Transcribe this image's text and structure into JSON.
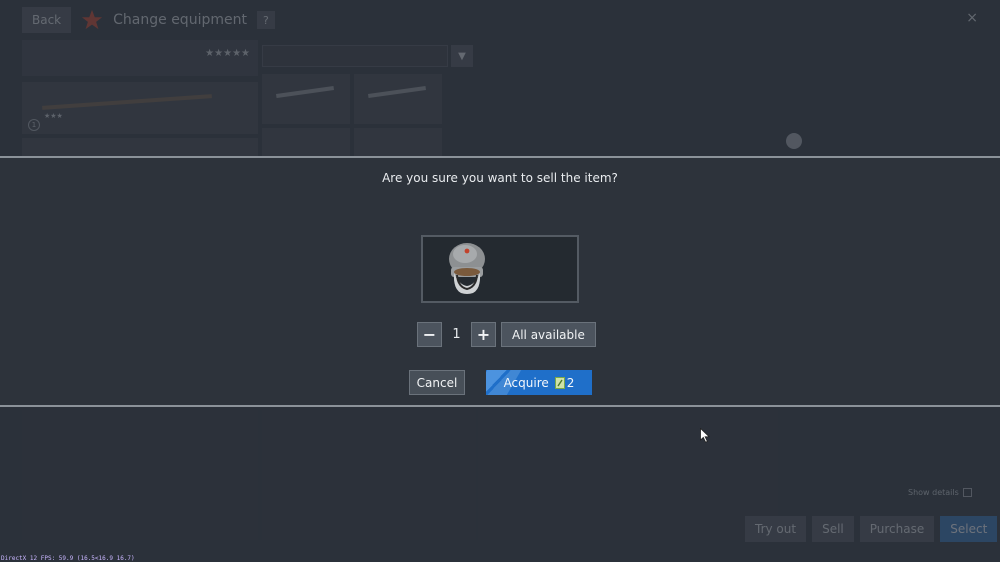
{
  "background": {
    "back_label": "Back",
    "page_title": "Change equipment",
    "help_label": "?",
    "close_label": "×",
    "soldier": {
      "stats": "",
      "price": "",
      "name": "",
      "rating": "★★★★★"
    },
    "weapon_1": {
      "price": "",
      "name": "",
      "number": "1",
      "stars": "★★★"
    },
    "weapon_2": {
      "price": ""
    },
    "search_placeholder": "",
    "grid_items": [
      {
        "price": "",
        "name": ""
      },
      {
        "price": "",
        "name": ""
      },
      {
        "price": "",
        "name": ""
      },
      {
        "price": "",
        "name": ""
      }
    ],
    "stats": [
      {
        "label": "",
        "value": ""
      },
      {
        "label": "",
        "value": ""
      },
      {
        "label": "",
        "value": ""
      },
      {
        "label": "",
        "value": ""
      },
      {
        "label": "",
        "value": ""
      }
    ],
    "show_details_label": "Show details",
    "actions": {
      "try_out": "Try out",
      "sell": "Sell",
      "purchase": "Purchase",
      "select": "Select"
    }
  },
  "modal": {
    "question": "Are you sure you want to sell the item?",
    "item_icon": "ushanka-hat-icon",
    "quantity": "1",
    "minus_label": "−",
    "plus_label": "+",
    "all_available_label": "All available",
    "cancel_label": "Cancel",
    "acquire_label": "Acquire",
    "acquire_cost": "2",
    "currency_icon": "silver-coin-icon"
  },
  "overlay": {
    "fps_text": "DirectX 12 FPS: 59.9 (16.5<16.9 16.7)"
  },
  "colors": {
    "modal_bg": "#2d333b",
    "accent_blue": "#1f6fc9",
    "divider": "#8b9299"
  }
}
